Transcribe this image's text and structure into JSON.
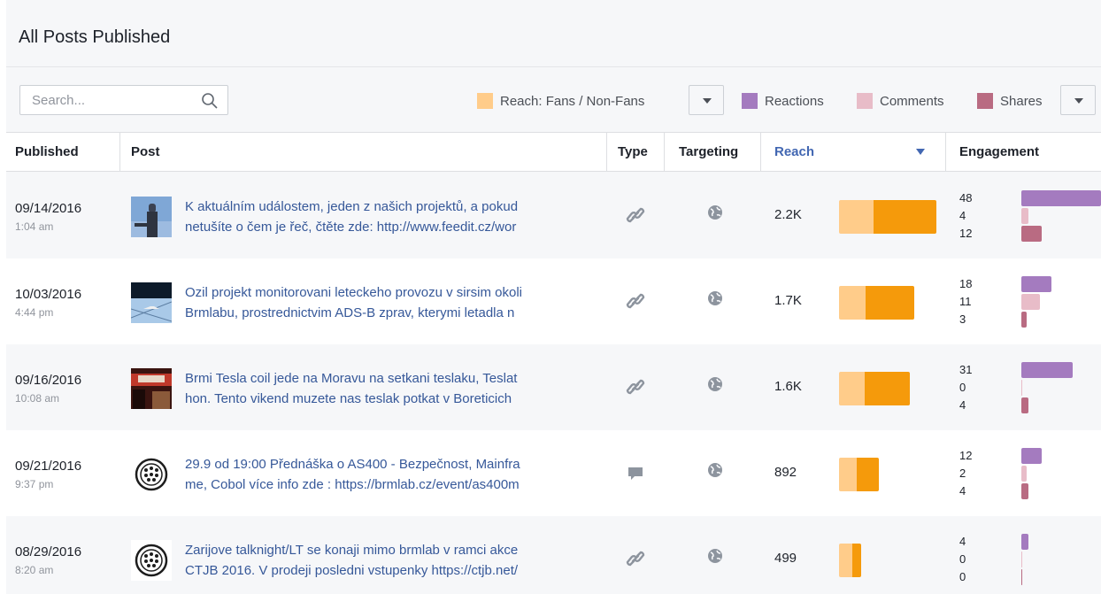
{
  "header": {
    "title": "All Posts Published"
  },
  "toolbar": {
    "search_placeholder": "Search...",
    "legend": {
      "reach_label": "Reach: Fans / Non-Fans",
      "reactions_label": "Reactions",
      "comments_label": "Comments",
      "shares_label": "Shares"
    },
    "colors": {
      "fans": "#ffcc8a",
      "non_fans": "#f59a0b",
      "reactions": "#a47bbf",
      "comments": "#e8bcc8",
      "shares": "#b96b82"
    }
  },
  "table": {
    "columns": {
      "published": "Published",
      "post": "Post",
      "type": "Type",
      "targeting": "Targeting",
      "reach": "Reach",
      "engagement": "Engagement"
    },
    "rows": [
      {
        "date": "09/14/2016",
        "time": "1:04 am",
        "text1": "K aktuálním událostem, jeden z našich projektů, a pokud",
        "text2": "netušíte o čem je řeč, čtěte zde: http://www.feedit.cz/wor",
        "type_icon": "link-icon",
        "reach": "2.2K",
        "reach_total": 2200,
        "fans_share": 0.35,
        "reactions": "48",
        "comments": "4",
        "shares": "12",
        "thumb": "person-sky"
      },
      {
        "date": "10/03/2016",
        "time": "4:44 pm",
        "text1": "Ozil projekt monitorovani leteckeho provozu v sirsim okoli",
        "text2": "Brmlabu, prostrednictvim ADS-B zprav, kterymi letadla n",
        "type_icon": "link-icon",
        "reach": "1.7K",
        "reach_total": 1700,
        "fans_share": 0.35,
        "reactions": "18",
        "comments": "11",
        "shares": "3",
        "thumb": "airplane-map"
      },
      {
        "date": "09/16/2016",
        "time": "10:08 am",
        "text1": "Brmi Tesla coil jede na Moravu na setkani teslaku, Teslat",
        "text2": "hon. Tento vikend muzete nas teslak potkat v Boreticich",
        "type_icon": "link-icon",
        "reach": "1.6K",
        "reach_total": 1600,
        "fans_share": 0.36,
        "reactions": "31",
        "comments": "0",
        "shares": "4",
        "thumb": "tesla-photo"
      },
      {
        "date": "09/21/2016",
        "time": "9:37 pm",
        "text1": "29.9 od 19:00 Přednáška o AS400 - Bezpečnost, Mainfra",
        "text2": "me, Cobol více info zde : https://brmlab.cz/event/as400m",
        "type_icon": "comment-icon",
        "reach": "892",
        "reach_total": 892,
        "fans_share": 0.45,
        "reactions": "12",
        "comments": "2",
        "shares": "4",
        "thumb": "brmlab-logo"
      },
      {
        "date": "08/29/2016",
        "time": "8:20 am",
        "text1": "Zarijove talknight/LT se konaji mimo brmlab v ramci akce",
        "text2": "CTJB 2016. V prodeji posledni vstupenky https://ctjb.net/",
        "type_icon": "link-icon",
        "reach": "499",
        "reach_total": 499,
        "fans_share": 0.6,
        "reactions": "4",
        "comments": "0",
        "shares": "0",
        "thumb": "brmlab-logo"
      }
    ]
  }
}
